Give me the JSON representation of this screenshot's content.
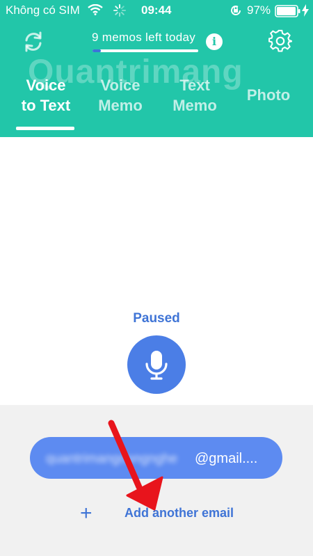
{
  "status_bar": {
    "carrier": "Không có SIM",
    "time": "09:44",
    "battery": "97%",
    "icons": [
      "wifi-icon",
      "loading-spinner-icon",
      "orientation-lock-icon",
      "battery-icon",
      "charging-bolt-icon"
    ]
  },
  "header": {
    "memos_left": "9 memos left today",
    "memos_progress_fraction": 0.08,
    "sync_icon": "sync-icon",
    "info_glyph": "i",
    "settings_icon": "gear-icon",
    "tabs": [
      {
        "line1": "Voice",
        "line2": "to Text",
        "active": true
      },
      {
        "line1": "Voice",
        "line2": "Memo",
        "active": false
      },
      {
        "line1": "Text",
        "line2": "Memo",
        "active": false
      },
      {
        "line1": "Photo",
        "line2": "",
        "active": false
      }
    ],
    "watermark": "Quantrimang"
  },
  "recorder": {
    "status": "Paused",
    "mic_icon": "microphone-icon"
  },
  "email": {
    "blurred_user": "quantrimangcongnghe",
    "domain": "@gmail....",
    "add_icon": "plus-icon",
    "add_label": "Add another email"
  },
  "colors": {
    "header_bg": "#22c6a9",
    "accent_blue": "#3f74d6",
    "mic_bg": "#4b7ee6",
    "email_pill": "#5d8bf1",
    "panel_bg": "#f1f1f1",
    "annotation_red": "#e8141c"
  }
}
